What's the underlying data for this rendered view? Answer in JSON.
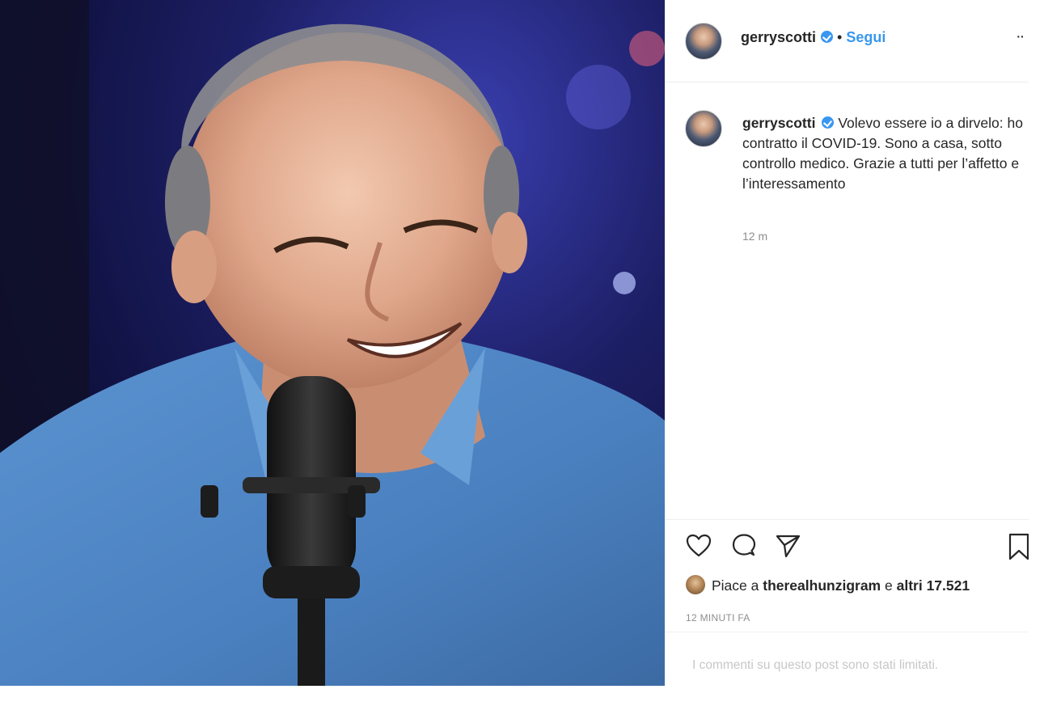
{
  "post": {
    "username": "gerryscotti",
    "follow_label": "Segui",
    "separator": "•",
    "more_label": "··",
    "caption": "Volevo essere io a dirvelo: ho contratto il COVID-19. Sono a casa, sotto controllo medico. Grazie a tutti per l’affetto e l’interessamento",
    "caption_age": "12 m",
    "likes_prefix": "Piace a",
    "likes_user": "therealhunzigram",
    "likes_connector": "e",
    "likes_count": "altri 17.521",
    "posted_ago": "12 MINUTI FA",
    "comments_limited": "I commenti su questo post sono stati limitati."
  },
  "icons": {
    "like": "heart-icon",
    "comment": "comment-icon",
    "share": "send-icon",
    "save": "bookmark-icon",
    "verified": "verified-badge-icon"
  },
  "colors": {
    "link_blue": "#3897f0",
    "text": "#262626",
    "muted": "#8e8e8e",
    "divider": "#efefef",
    "shirt_blue": "#4f86c6"
  }
}
